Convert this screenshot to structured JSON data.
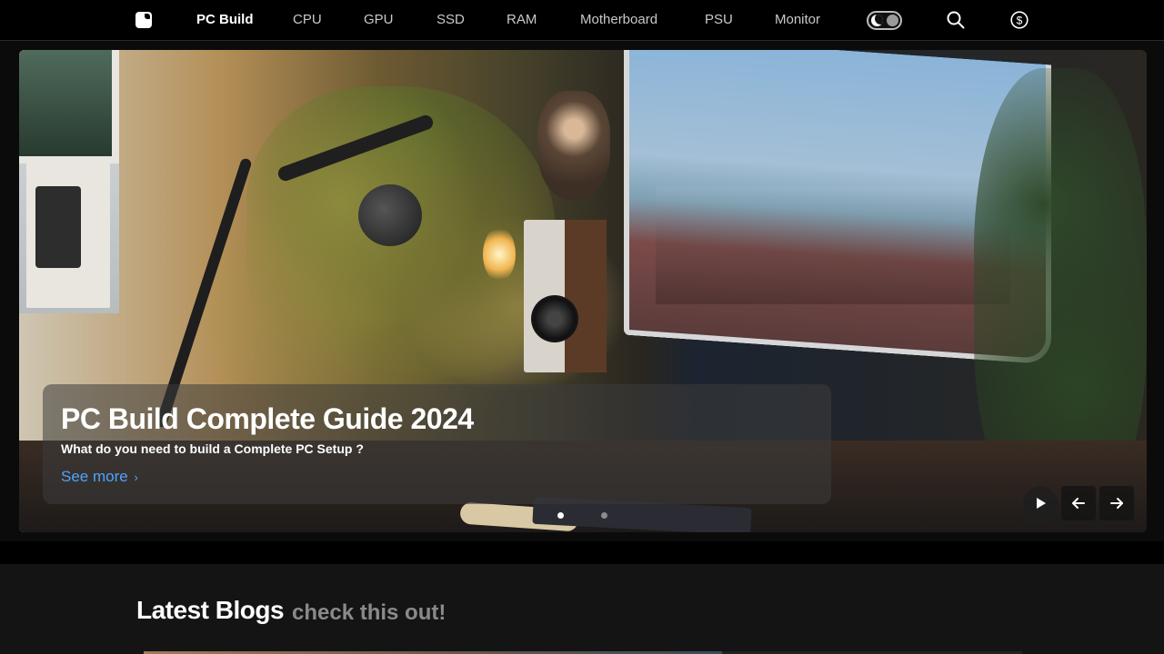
{
  "nav": {
    "logo_icon": "apple-logo-icon",
    "links": [
      "PC Build",
      "CPU",
      "GPU",
      "SSD",
      "RAM",
      "Motherboard",
      "PSU",
      "Monitor"
    ],
    "active": "PC Build",
    "theme_toggle_icon": "moon-icon",
    "search_icon": "search-icon",
    "currency_icon": "dollar-icon"
  },
  "hero": {
    "title": "PC Build Complete Guide 2024",
    "subtitle": "What do you need to build a Complete PC Setup ?",
    "link_label": "See more",
    "link_chevron": "›",
    "slide_count": 2,
    "active_slide": 1,
    "play_icon": "play-icon",
    "prev_icon": "arrow-left-icon",
    "next_icon": "arrow-right-icon"
  },
  "blogs": {
    "title": "Latest Blogs",
    "subtitle": "check this out!"
  },
  "colors": {
    "link": "#4ea3ff",
    "background": "#0b0b0b",
    "section": "#141414"
  }
}
